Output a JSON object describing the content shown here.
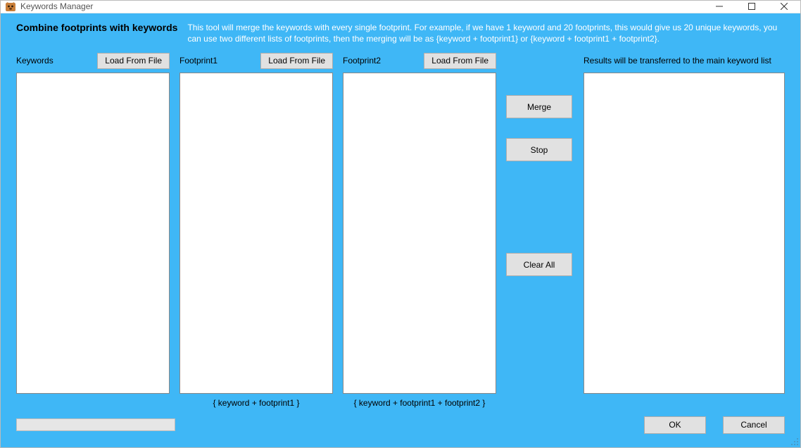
{
  "window": {
    "title": "Keywords Manager"
  },
  "header": {
    "heading": "Combine footprints with keywords",
    "description": "This tool will merge the keywords with every single footprint. For example, if we have 1 keyword and 20 footprints, this would give us 20 unique keywords, you can use two different lists of footprints, then the merging will be as {keyword + footprint1} or {keyword + footprint1 + footprint2}."
  },
  "columns": {
    "keywords": {
      "label": "Keywords",
      "load_label": "Load From File",
      "value": ""
    },
    "footprint1": {
      "label": "Footprint1",
      "load_label": "Load From File",
      "value": "",
      "hint": "{ keyword + footprint1 }"
    },
    "footprint2": {
      "label": "Footprint2",
      "load_label": "Load From File",
      "value": "",
      "hint": "{ keyword + footprint1 + footprint2 }"
    },
    "results": {
      "label": "Results will be transferred to the main keyword list",
      "value": ""
    }
  },
  "actions": {
    "merge": "Merge",
    "stop": "Stop",
    "clear_all": "Clear All"
  },
  "footer": {
    "ok": "OK",
    "cancel": "Cancel"
  }
}
